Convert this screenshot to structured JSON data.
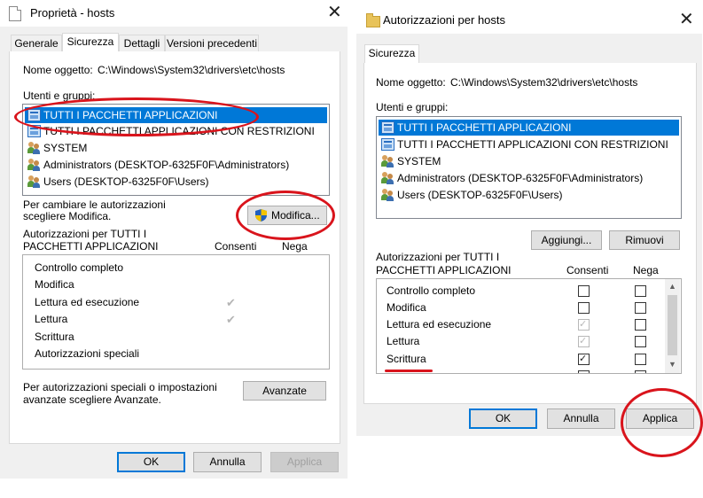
{
  "left": {
    "title": "Proprietà - hosts",
    "tabs": [
      "Generale",
      "Sicurezza",
      "Dettagli",
      "Versioni precedenti"
    ],
    "object_label": "Nome oggetto:",
    "object_value": "C:\\Windows\\System32\\drivers\\etc\\hosts",
    "groups_label": "Utenti e gruppi:",
    "groups": [
      {
        "label": "TUTTI I PACCHETTI APPLICAZIONI",
        "icon": "app-package-icon",
        "selected": true
      },
      {
        "label": "TUTTI I PACCHETTI APPLICAZIONI CON RESTRIZIONI",
        "icon": "app-package-icon",
        "selected": false
      },
      {
        "label": "SYSTEM",
        "icon": "users-icon",
        "selected": false
      },
      {
        "label": "Administrators (DESKTOP-6325F0F\\Administrators)",
        "icon": "users-icon",
        "selected": false
      },
      {
        "label": "Users (DESKTOP-6325F0F\\Users)",
        "icon": "users-icon",
        "selected": false
      }
    ],
    "change_hint_1": "Per cambiare le autorizzazioni",
    "change_hint_2": "scegliere Modifica.",
    "edit_button": "Modifica...",
    "perm_title_1": "Autorizzazioni per TUTTI I",
    "perm_title_2": "PACCHETTI APPLICAZIONI",
    "col_allow": "Consenti",
    "col_deny": "Nega",
    "permissions": [
      {
        "label": "Controllo completo",
        "allow": false
      },
      {
        "label": "Modifica",
        "allow": false
      },
      {
        "label": "Lettura ed esecuzione",
        "allow": true
      },
      {
        "label": "Lettura",
        "allow": true
      },
      {
        "label": "Scrittura",
        "allow": false
      },
      {
        "label": "Autorizzazioni speciali",
        "allow": false
      }
    ],
    "advanced_hint_1": "Per autorizzazioni speciali o impostazioni",
    "advanced_hint_2": "avanzate scegliere Avanzate.",
    "advanced_button": "Avanzate",
    "ok": "OK",
    "cancel": "Annulla",
    "apply": "Applica"
  },
  "right": {
    "title": "Autorizzazioni per hosts",
    "tab": "Sicurezza",
    "object_label": "Nome oggetto:",
    "object_value": "C:\\Windows\\System32\\drivers\\etc\\hosts",
    "groups_label": "Utenti e gruppi:",
    "groups": [
      {
        "label": "TUTTI I PACCHETTI APPLICAZIONI",
        "icon": "app-package-icon",
        "selected": true
      },
      {
        "label": "TUTTI I PACCHETTI APPLICAZIONI CON RESTRIZIONI",
        "icon": "app-package-icon",
        "selected": false
      },
      {
        "label": "SYSTEM",
        "icon": "users-icon",
        "selected": false
      },
      {
        "label": "Administrators (DESKTOP-6325F0F\\Administrators)",
        "icon": "users-icon",
        "selected": false
      },
      {
        "label": "Users (DESKTOP-6325F0F\\Users)",
        "icon": "users-icon",
        "selected": false
      }
    ],
    "add_button": "Aggiungi...",
    "remove_button": "Rimuovi",
    "perm_title_1": "Autorizzazioni per TUTTI I",
    "perm_title_2": "PACCHETTI APPLICAZIONI",
    "col_allow": "Consenti",
    "col_deny": "Nega",
    "permissions": [
      {
        "label": "Controllo completo",
        "allow": false,
        "allow_disabled": false,
        "deny": false
      },
      {
        "label": "Modifica",
        "allow": false,
        "allow_disabled": false,
        "deny": false
      },
      {
        "label": "Lettura ed esecuzione",
        "allow": true,
        "allow_disabled": true,
        "deny": false
      },
      {
        "label": "Lettura",
        "allow": true,
        "allow_disabled": true,
        "deny": false
      },
      {
        "label": "Scrittura",
        "allow": true,
        "allow_disabled": false,
        "deny": false
      }
    ],
    "ok": "OK",
    "cancel": "Annulla",
    "apply": "Applica"
  },
  "annotation_color": "#d9141c",
  "selection_color": "#0078d7"
}
